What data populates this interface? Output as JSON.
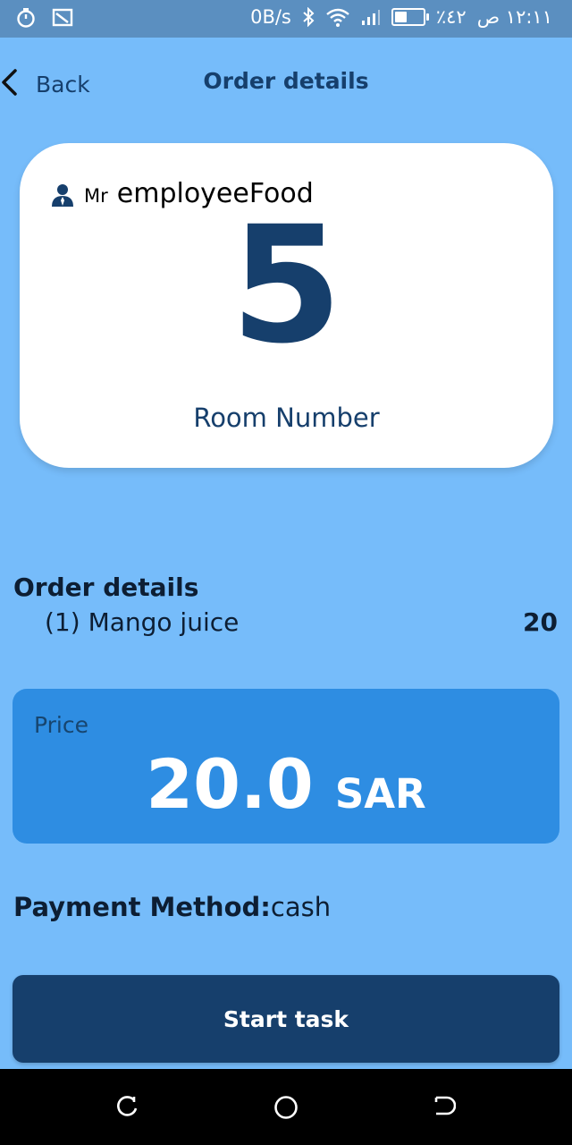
{
  "status_bar": {
    "network_speed": "0B/s",
    "battery_percent": "٪٤٢",
    "time": "١٢:١١ ص",
    "battery_level": 0.42
  },
  "header": {
    "back_label": "Back",
    "title": "Order details"
  },
  "guest_card": {
    "icon": "person-icon",
    "prefix": "Mr",
    "name": "employeeFood",
    "room_number": "5",
    "room_label": "Room Number"
  },
  "order": {
    "title": "Order details",
    "items": [
      {
        "label": "(1) Mango juice",
        "amount": "20"
      }
    ]
  },
  "price": {
    "label": "Price",
    "value": "20.0",
    "currency": "SAR"
  },
  "payment": {
    "label": "Payment Method:",
    "value": "cash"
  },
  "actions": {
    "start_label": "Start task"
  },
  "colors": {
    "background": "#76bcfa",
    "primary": "#163f6c",
    "price_card": "#2e8de2",
    "card": "#ffffff"
  }
}
